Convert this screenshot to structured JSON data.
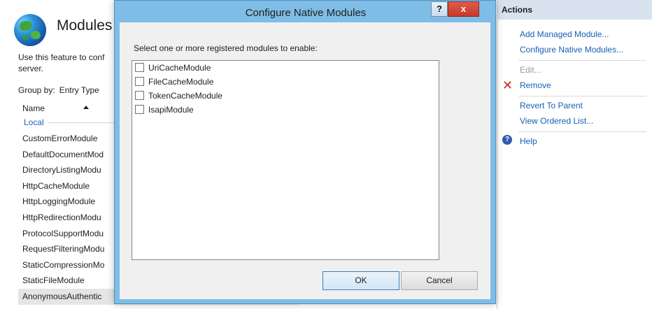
{
  "background": {
    "page_title": "Modules",
    "description": "Use this feature to conf server.",
    "description_line1": "Use this feature to conf",
    "description_line2": "server.",
    "group_by_label": "Group by:",
    "group_by_value": "Entry Type",
    "column_header": "Name",
    "group_label": "Local",
    "modules": [
      "CustomErrorModule",
      "DefaultDocumentMod",
      "DirectoryListingModu",
      "HttpCacheModule",
      "HttpLoggingModule",
      "HttpRedirectionModu",
      "ProtocolSupportModu",
      "RequestFilteringModu",
      "StaticCompressionMo",
      "StaticFileModule",
      "AnonymousAuthentic"
    ]
  },
  "actions": {
    "header": "Actions",
    "items": [
      {
        "label": "Add Managed Module...",
        "enabled": true
      },
      {
        "label": "Configure Native Modules...",
        "enabled": true
      },
      {
        "label": "Edit...",
        "enabled": false
      },
      {
        "label": "Remove",
        "enabled": true,
        "icon": "red-x-icon"
      },
      {
        "label": "Revert To Parent",
        "enabled": true
      },
      {
        "label": "View Ordered List...",
        "enabled": true
      },
      {
        "label": "Help",
        "enabled": true,
        "icon": "help-icon"
      }
    ]
  },
  "dialog": {
    "title": "Configure Native Modules",
    "help_glyph": "?",
    "close_glyph": "x",
    "prompt": "Select one or more registered modules to enable:",
    "modules": [
      {
        "label": "UriCacheModule",
        "checked": false
      },
      {
        "label": "FileCacheModule",
        "checked": false
      },
      {
        "label": "TokenCacheModule",
        "checked": false
      },
      {
        "label": "IsapiModule",
        "checked": false
      }
    ],
    "ok_label": "OK",
    "cancel_label": "Cancel"
  },
  "colors": {
    "dialog_frame": "#7fbde6",
    "link": "#1660b4",
    "actions_header": "#d7e2ee",
    "close_button": "#c7392a"
  }
}
